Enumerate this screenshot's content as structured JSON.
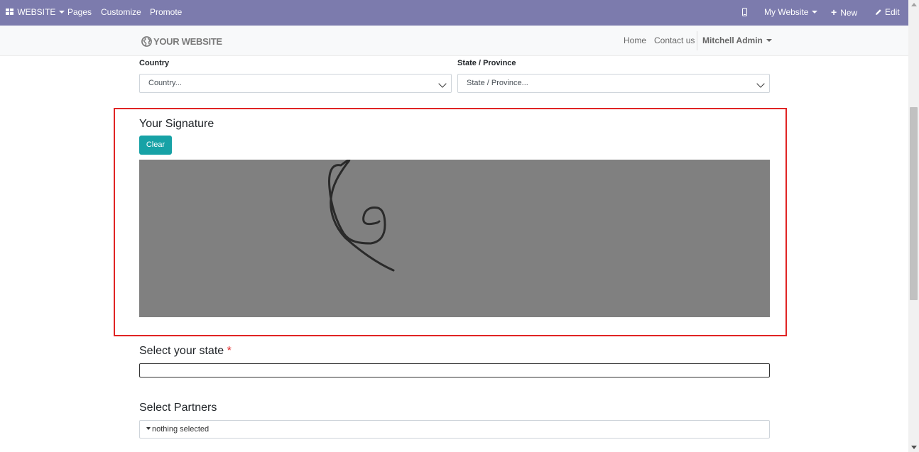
{
  "topbar": {
    "app_label": "WEBSITE",
    "menu": [
      "Pages",
      "Customize",
      "Promote"
    ],
    "website_switcher": "My Website",
    "new_label": "New",
    "edit_label": "Edit"
  },
  "navbar": {
    "brand": "YOUR WEBSITE",
    "links": [
      "Home",
      "Contact us"
    ],
    "user": "Mitchell Admin"
  },
  "form": {
    "country": {
      "label": "Country",
      "placeholder": "Country..."
    },
    "state": {
      "label": "State / Province",
      "placeholder": "State / Province..."
    },
    "signature": {
      "title": "Your Signature",
      "clear_label": "Clear"
    },
    "select_state": {
      "label": "Select your state",
      "required_mark": "*",
      "value": ""
    },
    "select_partners": {
      "label": "Select Partners",
      "value": "nothing selected"
    }
  },
  "colors": {
    "topbar": "#7c7bad",
    "accent_button": "#17a2a6",
    "highlight_border": "#e02424",
    "signature_pad": "#808080"
  },
  "icons": [
    "apps-grid-icon",
    "mobile-preview-icon",
    "plus-icon",
    "pencil-icon",
    "globe-icon",
    "chevron-down-icon"
  ]
}
